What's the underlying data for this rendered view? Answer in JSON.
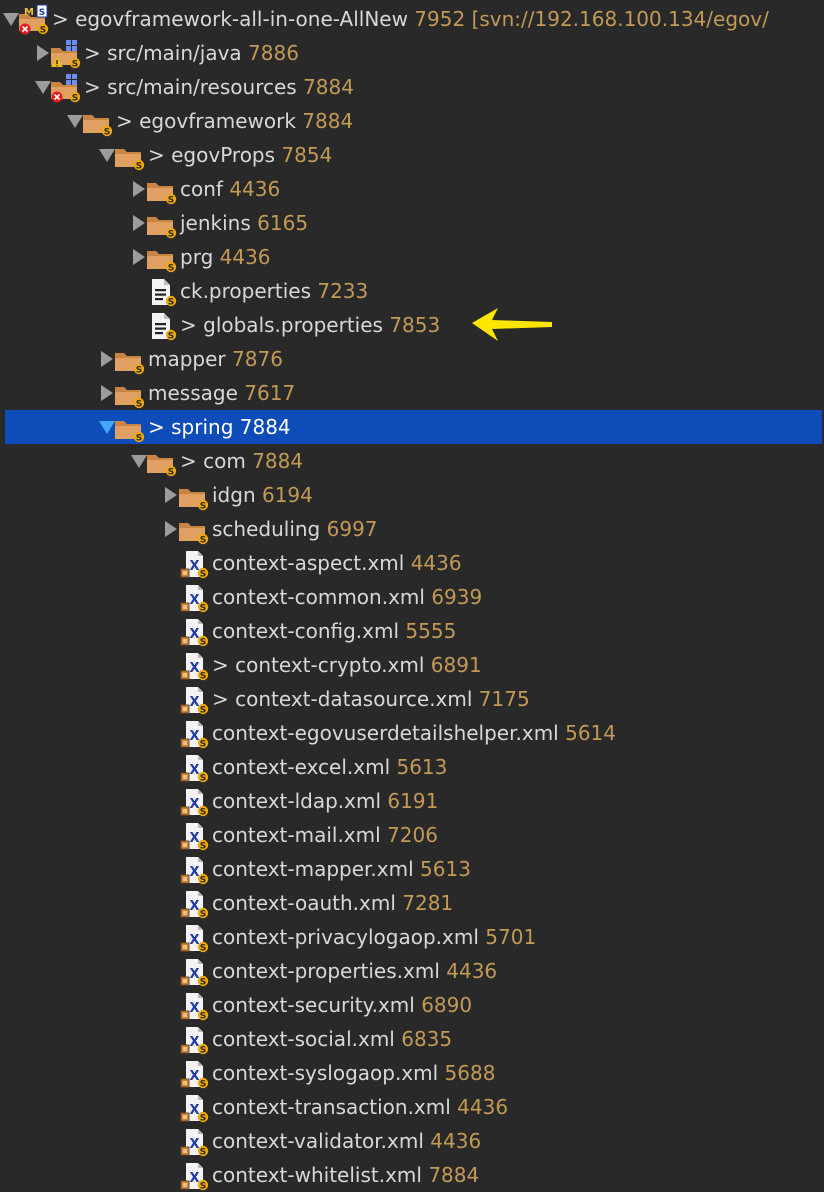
{
  "tree": {
    "rows": [
      {
        "name": "egovframework-all-in-one-AllNew",
        "rev": "7952",
        "suffix": "[svn://192.168.100.134/egov/",
        "prefix": "> ",
        "toggle": "expanded",
        "icon": "maven-project-icon",
        "overlay": "error"
      },
      {
        "name": "src/main/java",
        "rev": "7886",
        "prefix": "> ",
        "toggle": "collapsed",
        "icon": "package-folder-icon",
        "overlay": "warning"
      },
      {
        "name": "src/main/resources",
        "rev": "7884",
        "prefix": "> ",
        "toggle": "expanded",
        "icon": "package-folder-icon",
        "overlay": "error"
      },
      {
        "name": "egovframework",
        "rev": "7884",
        "prefix": "> ",
        "toggle": "expanded",
        "icon": "folder-icon"
      },
      {
        "name": "egovProps",
        "rev": "7854",
        "prefix": "> ",
        "toggle": "expanded",
        "icon": "folder-icon"
      },
      {
        "name": "conf",
        "rev": "4436",
        "prefix": "",
        "toggle": "collapsed",
        "icon": "folder-icon"
      },
      {
        "name": "jenkins",
        "rev": "6165",
        "prefix": "",
        "toggle": "collapsed",
        "icon": "folder-icon"
      },
      {
        "name": "prg",
        "rev": "4436",
        "prefix": "",
        "toggle": "collapsed",
        "icon": "folder-icon"
      },
      {
        "name": "ck.properties",
        "rev": "7233",
        "prefix": "",
        "toggle": "none",
        "icon": "properties-file-icon"
      },
      {
        "name": "globals.properties",
        "rev": "7853",
        "prefix": "> ",
        "toggle": "none",
        "icon": "properties-file-icon"
      },
      {
        "name": "mapper",
        "rev": "7876",
        "prefix": "",
        "toggle": "collapsed",
        "icon": "folder-icon"
      },
      {
        "name": "message",
        "rev": "7617",
        "prefix": "",
        "toggle": "collapsed",
        "icon": "folder-icon"
      },
      {
        "name": "spring",
        "rev": "7884",
        "prefix": "> ",
        "toggle": "expanded",
        "icon": "folder-icon",
        "selected": true
      },
      {
        "name": "com",
        "rev": "7884",
        "prefix": "> ",
        "toggle": "expanded",
        "icon": "folder-icon"
      },
      {
        "name": "idgn",
        "rev": "6194",
        "prefix": "",
        "toggle": "collapsed",
        "icon": "folder-icon"
      },
      {
        "name": "scheduling",
        "rev": "6997",
        "prefix": "",
        "toggle": "collapsed",
        "icon": "folder-icon"
      },
      {
        "name": "context-aspect.xml",
        "rev": "4436",
        "prefix": "",
        "toggle": "none",
        "icon": "xml-file-icon"
      },
      {
        "name": "context-common.xml",
        "rev": "6939",
        "prefix": "",
        "toggle": "none",
        "icon": "xml-file-icon"
      },
      {
        "name": "context-config.xml",
        "rev": "5555",
        "prefix": "",
        "toggle": "none",
        "icon": "xml-file-icon"
      },
      {
        "name": "context-crypto.xml",
        "rev": "6891",
        "prefix": "> ",
        "toggle": "none",
        "icon": "xml-file-icon"
      },
      {
        "name": "context-datasource.xml",
        "rev": "7175",
        "prefix": "> ",
        "toggle": "none",
        "icon": "xml-file-icon"
      },
      {
        "name": "context-egovuserdetailshelper.xml",
        "rev": "5614",
        "prefix": "",
        "toggle": "none",
        "icon": "xml-file-icon"
      },
      {
        "name": "context-excel.xml",
        "rev": "5613",
        "prefix": "",
        "toggle": "none",
        "icon": "xml-file-icon"
      },
      {
        "name": "context-ldap.xml",
        "rev": "6191",
        "prefix": "",
        "toggle": "none",
        "icon": "xml-file-icon"
      },
      {
        "name": "context-mail.xml",
        "rev": "7206",
        "prefix": "",
        "toggle": "none",
        "icon": "xml-file-icon"
      },
      {
        "name": "context-mapper.xml",
        "rev": "5613",
        "prefix": "",
        "toggle": "none",
        "icon": "xml-file-icon"
      },
      {
        "name": "context-oauth.xml",
        "rev": "7281",
        "prefix": "",
        "toggle": "none",
        "icon": "xml-file-icon"
      },
      {
        "name": "context-privacylogaop.xml",
        "rev": "5701",
        "prefix": "",
        "toggle": "none",
        "icon": "xml-file-icon"
      },
      {
        "name": "context-properties.xml",
        "rev": "4436",
        "prefix": "",
        "toggle": "none",
        "icon": "xml-file-icon"
      },
      {
        "name": "context-security.xml",
        "rev": "6890",
        "prefix": "",
        "toggle": "none",
        "icon": "xml-file-icon"
      },
      {
        "name": "context-social.xml",
        "rev": "6835",
        "prefix": "",
        "toggle": "none",
        "icon": "xml-file-icon"
      },
      {
        "name": "context-syslogaop.xml",
        "rev": "5688",
        "prefix": "",
        "toggle": "none",
        "icon": "xml-file-icon"
      },
      {
        "name": "context-transaction.xml",
        "rev": "4436",
        "prefix": "",
        "toggle": "none",
        "icon": "xml-file-icon"
      },
      {
        "name": "context-validator.xml",
        "rev": "4436",
        "prefix": "",
        "toggle": "none",
        "icon": "xml-file-icon"
      },
      {
        "name": "context-whitelist.xml",
        "rev": "7884",
        "prefix": "",
        "toggle": "none",
        "icon": "xml-file-icon"
      }
    ]
  },
  "annotation": {
    "icon": "yellow-arrow-icon",
    "color": "#ffe600"
  },
  "colors": {
    "background": "#292929",
    "text": "#d8d8d8",
    "revision": "#c29a56",
    "selection": "#0e4cba",
    "folder": "#c98542",
    "svn_badge": "#f0a800"
  }
}
